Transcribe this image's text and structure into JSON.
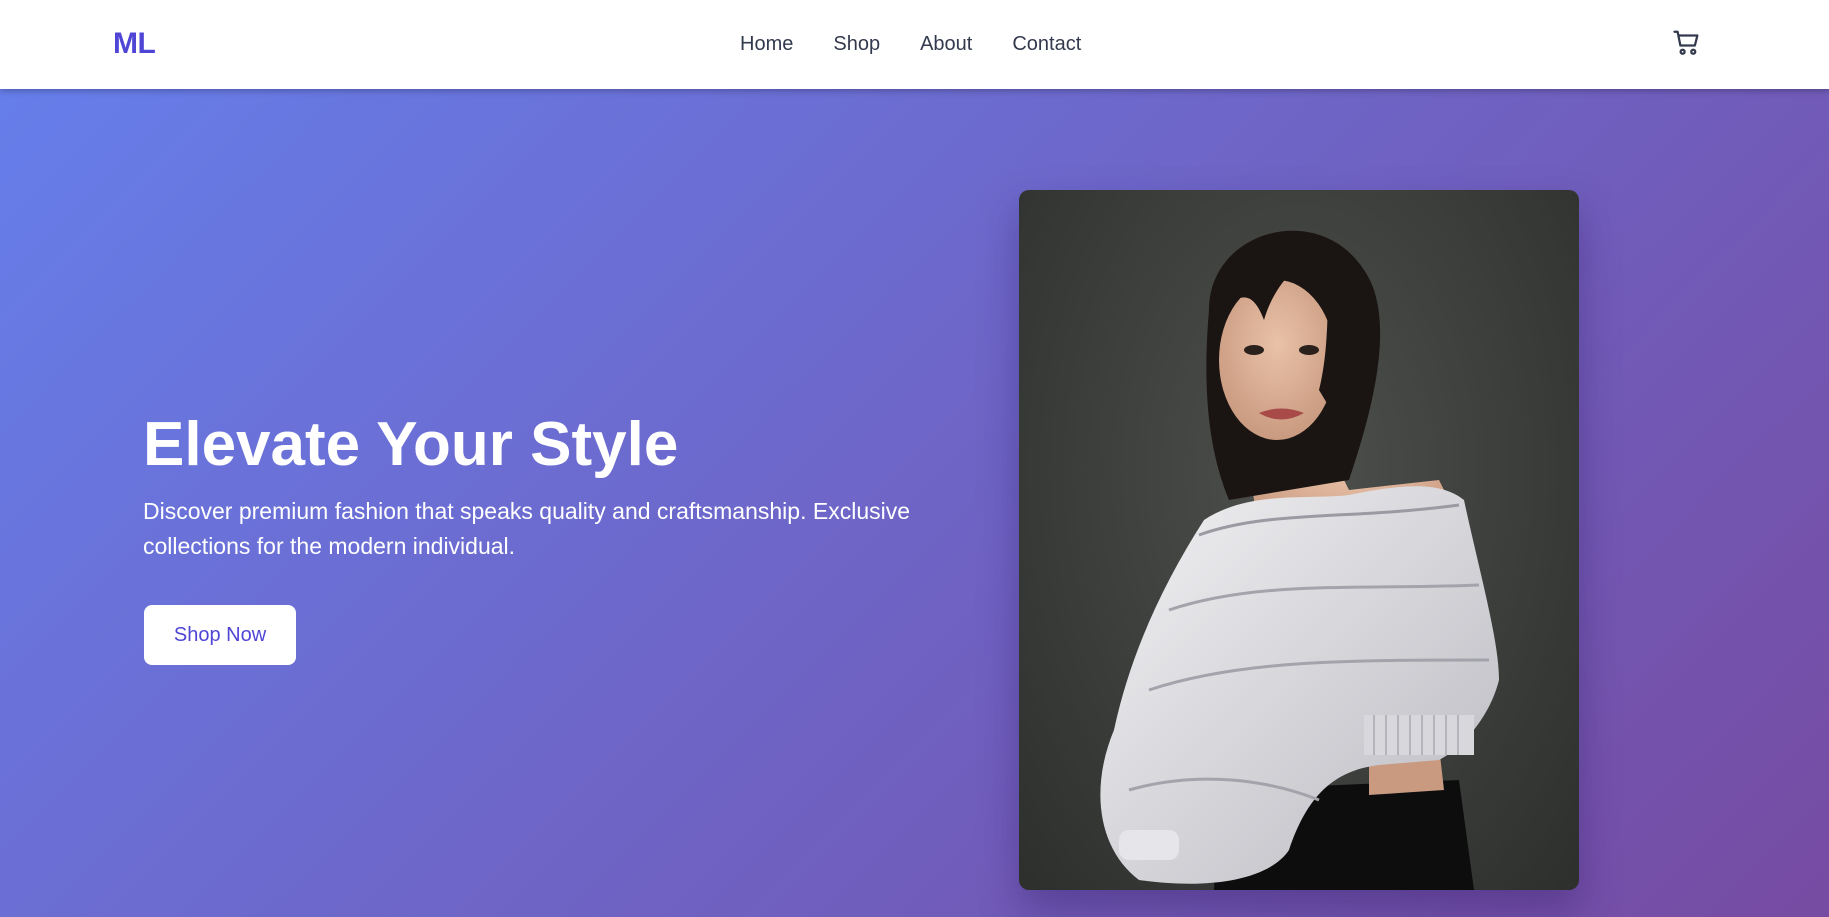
{
  "brand": {
    "logo_text": "ML",
    "accent_color": "#5046d6"
  },
  "nav": {
    "items": [
      {
        "label": "Home"
      },
      {
        "label": "Shop"
      },
      {
        "label": "About"
      },
      {
        "label": "Contact"
      }
    ],
    "cart_icon": "shopping-cart-icon"
  },
  "hero": {
    "title": "Elevate Your Style",
    "subtitle": "Discover premium fashion that speaks quality and craftsmanship. Exclusive collections for the modern individual.",
    "cta_label": "Shop Now",
    "gradient_start": "#667eea",
    "gradient_end": "#764ba2"
  }
}
